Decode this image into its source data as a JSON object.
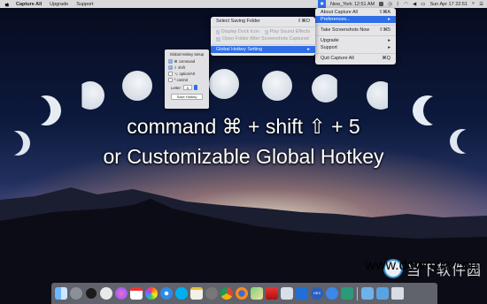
{
  "menubar": {
    "app_name": "Capture All",
    "items": [
      "Upgrade",
      "Support"
    ],
    "timezone": "New_York",
    "tz_time": "12:51 AM",
    "clock": "Sun Apr 17  22:51"
  },
  "app_menu": {
    "items": [
      {
        "label": "About Capture All",
        "shortcut": "⇧⌘A"
      },
      {
        "label": "Preferences...",
        "shortcut": "▸"
      },
      {
        "label": "Take Screenshots Now",
        "shortcut": "⇧⌘5"
      },
      {
        "label": "Upgrade",
        "shortcut": "▸"
      },
      {
        "label": "Support",
        "shortcut": "▸"
      },
      {
        "label": "Quit Capture All",
        "shortcut": "⌘Q"
      }
    ]
  },
  "prefs_menu": {
    "items": [
      {
        "label": "Select Saving Folder",
        "shortcut": "⇧⌘O"
      },
      {
        "label": "Display Dock Icon"
      },
      {
        "label": "Play Sound Effects"
      },
      {
        "label": "Open Folder After Screenshots Captured"
      },
      {
        "label": "Global Hotkey Setting",
        "shortcut": "▸"
      }
    ]
  },
  "hotkey_panel": {
    "title": "Global Hotkey Setup",
    "options": [
      {
        "label": "⌘ command",
        "checked": true
      },
      {
        "label": "⇧ shift",
        "checked": true
      },
      {
        "label": "⌥ option/Alt",
        "checked": false
      },
      {
        "label": "^ control",
        "checked": false
      }
    ],
    "letter_label": "Letter:",
    "letter_value": "5",
    "save_label": "Save Hotkey"
  },
  "caption": {
    "line1": "command ⌘ + shift ⇧ + 5",
    "line2": "or Customizable Global Hotkey"
  },
  "watermark": {
    "brand": "当下软件园",
    "url": "www.downxia.com"
  },
  "dock_icons": [
    "finder-icon",
    "launchpad-icon",
    "dashboard-icon",
    "clock-icon",
    "itunes-icon",
    "calendar-icon",
    "photos-icon",
    "safari-icon",
    "skype-icon",
    "notes-icon",
    "settings-icon",
    "chrome-icon",
    "firefox-icon",
    "maps-icon",
    "app-icon",
    "preview-icon",
    "books-icon",
    "hex-icon",
    "quicktime-icon",
    "capture-icon",
    "folder-icon",
    "downloads-icon",
    "trash-icon"
  ]
}
